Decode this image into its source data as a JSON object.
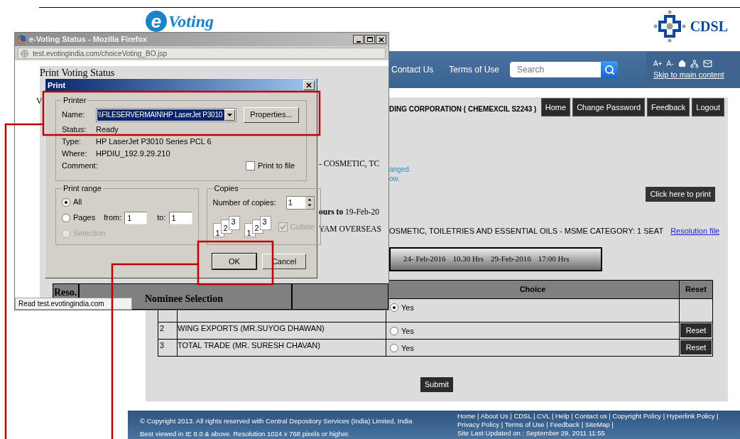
{
  "page": {
    "logo": {
      "mark": "e",
      "text": "Voting"
    },
    "brand": {
      "text": "CDSL"
    },
    "nav": {
      "items": [
        "Contact Us",
        "Terms of Use"
      ],
      "search": {
        "placeholder": "Search"
      },
      "font_controls": [
        "A+",
        "A-"
      ],
      "skip_link": "Skip to main content"
    },
    "user_header": "DING CORPORATION ( CHEMEXCIL S2243 )",
    "menu_buttons": [
      "Home",
      "Change Password",
      "Feedback",
      "Logout"
    ],
    "notice_lines": [
      "anged.",
      "ow."
    ],
    "print_button": "Click here to print",
    "resolution": {
      "text": "OSMETIC, TOILETRIES AND ESSENTIAL OILS - MSME CATEGORY: 1 SEAT",
      "link": "Resolution file"
    },
    "voting_period": [
      "24- Feb-2016",
      "10.30 Hrs",
      "29-Feb-2016",
      "17:00 Hrs"
    ],
    "table": {
      "columns": [
        "Choice",
        "Reset"
      ],
      "rows": [
        {
          "choice": "Yes",
          "selected": true
        },
        {
          "number": "2",
          "name": "WING EXPORTS (MR.SUYOG DHAWAN)",
          "choice": "Yes",
          "selected": false,
          "reset": "Reset"
        },
        {
          "number": "3",
          "name": "TOTAL TRADE (MR. SURESH CHAVAN)",
          "choice": "Yes",
          "selected": false,
          "reset": "Reset"
        }
      ]
    },
    "submit": "Submit",
    "footer": {
      "left_lines": [
        "© Copyright 2013. All rights reserved with Central Depository Services (India) Limited, India",
        "Best viewed in IE 8.0 & above. Resolution 1024 x 768 pixels or higher."
      ],
      "link_lines": [
        "Home | About Us | CDSL | CVL | Help | Contact us | Copyright Policy | Hyperlink Policy |",
        "Privacy Policy | Terms of Use | Feedback | SiteMap |"
      ],
      "updated": "Site Last Updated on : September 29, 2011 11:55"
    }
  },
  "browser_window": {
    "title": "e-Voting Status - Mozilla Firefox",
    "url": "test.evotingindia.com/choiceVoting_BO.jsp",
    "status": "Read test.evotingindia.com",
    "content": {
      "heading": "Print Voting Status",
      "fragment": "V",
      "lines": [
        "- COSMETIC, TC",
        "**ours to** 19-Feb-20",
        "YAM OVERSEAS"
      ],
      "table_columns": [
        "Reso.",
        "Nominee Selection"
      ]
    }
  },
  "print_dialog": {
    "title": "Print",
    "printer": {
      "legend": "Printer",
      "name_label": "Name:",
      "name_value": "\\\\FILESERVERMAIN\\HP LaserJet P3010",
      "properties": "Properties...",
      "details": [
        {
          "label": "Status:",
          "value": "Ready"
        },
        {
          "label": "Type:",
          "value": "HP LaserJet P3010 Series PCL 6"
        },
        {
          "label": "Where:",
          "value": "HPDIU_192.9.29.210"
        },
        {
          "label": "Comment:"
        }
      ],
      "print_to_file": {
        "label": "Print to file",
        "checked": false
      }
    },
    "print_range": {
      "legend": "Print range",
      "options": [
        {
          "label": "All",
          "selected": true,
          "disabled": false
        },
        {
          "label": "Pages",
          "selected": false,
          "disabled": false
        },
        {
          "label": "Selection",
          "selected": false,
          "disabled": true
        }
      ],
      "from_label": "from:",
      "from_value": "1",
      "to_label": "to:",
      "to_value": "1"
    },
    "copies": {
      "legend": "Copies",
      "label": "Number of copies:",
      "value": "1",
      "page_stacks": [
        [
          "1",
          "2",
          "3"
        ],
        [
          "1",
          "2",
          "3"
        ]
      ],
      "collate": {
        "label": "Collate",
        "checked": true,
        "disabled": true
      }
    },
    "buttons": [
      "OK",
      "Cancel"
    ]
  }
}
